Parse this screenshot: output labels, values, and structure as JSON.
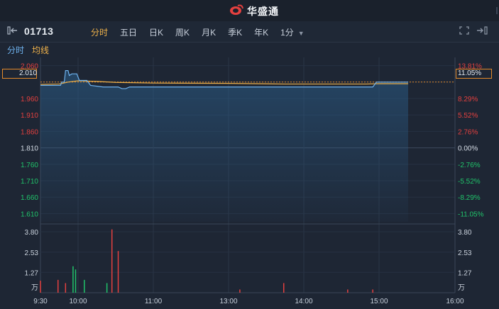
{
  "brand": {
    "name": "华盛通",
    "icon": "huasheng-logo-icon"
  },
  "stock": {
    "code": "01713",
    "back_icon": "collapse-panel-icon"
  },
  "tabs": [
    {
      "label": "分时",
      "active": true
    },
    {
      "label": "五日",
      "active": false
    },
    {
      "label": "日K",
      "active": false
    },
    {
      "label": "周K",
      "active": false
    },
    {
      "label": "月K",
      "active": false
    },
    {
      "label": "季K",
      "active": false
    },
    {
      "label": "年K",
      "active": false
    },
    {
      "label": "1分",
      "active": false,
      "dropdown": true
    }
  ],
  "tools": {
    "fullscreen_icon": "fullscreen-icon",
    "expand_icon": "expand-right-icon"
  },
  "legend": {
    "price": "分时",
    "avg": "均线"
  },
  "colors": {
    "up": "#e3403f",
    "down": "#20c36a",
    "price_line": "#6fb3ef",
    "avg_line": "#f0b24a",
    "highlight": "#e38a2a"
  },
  "current": {
    "price": "2.010",
    "pct": "11.05%"
  },
  "price_axis": [
    "2.060",
    "2.010",
    "1.960",
    "1.910",
    "1.860",
    "1.810",
    "1.760",
    "1.710",
    "1.660",
    "1.610"
  ],
  "pct_axis": [
    "13.81%",
    "11.05%",
    "8.29%",
    "5.52%",
    "2.76%",
    "0.00%",
    "-2.76%",
    "-5.52%",
    "-8.29%",
    "-11.05%"
  ],
  "volume_axis_left": [
    "3.80",
    "2.53",
    "1.27",
    "万"
  ],
  "volume_axis_right": [
    "3.80",
    "2.53",
    "1.27",
    "万"
  ],
  "time_axis": [
    "9:30",
    "10:00",
    "11:00",
    "13:00",
    "14:00",
    "15:00",
    "16:00"
  ],
  "chart_data": {
    "type": "line",
    "prev_close": 1.81,
    "ylim": [
      1.585,
      2.085
    ],
    "series": [
      {
        "role": "price",
        "points": [
          [
            "9:30",
            2.0
          ],
          [
            "9:46",
            2.0
          ],
          [
            "9:47",
            2.01
          ],
          [
            "9:49",
            2.01
          ],
          [
            "9:50",
            2.045
          ],
          [
            "9:52",
            2.045
          ],
          [
            "9:53",
            2.03
          ],
          [
            "9:55",
            2.035
          ],
          [
            "9:59",
            2.035
          ],
          [
            "10:01",
            2.015
          ],
          [
            "10:07",
            2.015
          ],
          [
            "10:10",
            2.0
          ],
          [
            "10:20",
            1.995
          ],
          [
            "10:32",
            1.995
          ],
          [
            "10:35",
            1.99
          ],
          [
            "10:38",
            1.99
          ],
          [
            "10:41",
            1.995
          ],
          [
            "12:59",
            1.995
          ],
          [
            "14:00",
            1.995
          ],
          [
            "14:55",
            1.995
          ],
          [
            "14:58",
            2.01
          ],
          [
            "15:23",
            2.01
          ]
        ]
      },
      {
        "role": "average",
        "points": [
          [
            "9:30",
            2.003
          ],
          [
            "9:45",
            2.004
          ],
          [
            "9:52",
            2.01
          ],
          [
            "10:00",
            2.014
          ],
          [
            "10:15",
            2.012
          ],
          [
            "10:30",
            2.009
          ],
          [
            "11:00",
            2.007
          ],
          [
            "13:00",
            2.006
          ],
          [
            "13:45",
            2.004
          ],
          [
            "14:00",
            2.004
          ],
          [
            "14:50",
            2.004
          ],
          [
            "15:00",
            2.005
          ],
          [
            "15:23",
            2.005
          ]
        ]
      }
    ],
    "volume": {
      "unit": "万",
      "ylim": [
        0,
        4.2
      ],
      "bars": [
        [
          "9:30",
          0.75,
          "up"
        ],
        [
          "9:44",
          0.8,
          "up"
        ],
        [
          "9:50",
          0.6,
          "up"
        ],
        [
          "9:56",
          1.65,
          "down"
        ],
        [
          "9:58",
          1.45,
          "down"
        ],
        [
          "10:05",
          0.8,
          "down"
        ],
        [
          "10:23",
          0.6,
          "down"
        ],
        [
          "10:27",
          3.95,
          "up"
        ],
        [
          "10:32",
          2.6,
          "up"
        ],
        [
          "13:09",
          0.2,
          "up"
        ],
        [
          "13:44",
          0.6,
          "up"
        ],
        [
          "14:35",
          0.2,
          "up"
        ],
        [
          "14:55",
          0.2,
          "up"
        ]
      ]
    }
  }
}
